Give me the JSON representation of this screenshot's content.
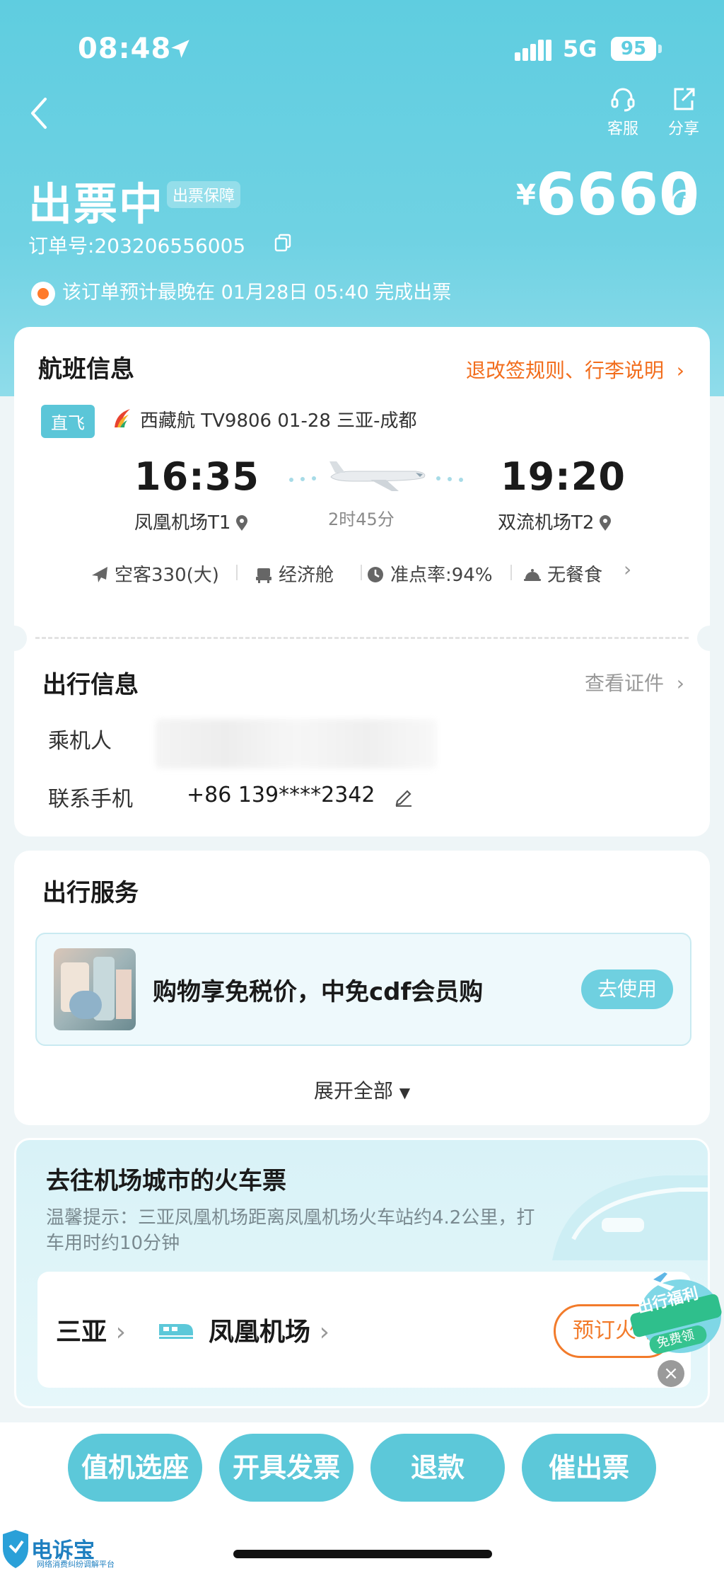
{
  "status_bar": {
    "time": "08:48",
    "network": "5G",
    "battery": "95"
  },
  "header": {
    "service_label": "客服",
    "share_label": "分享",
    "title": "出票中",
    "guarantee_badge": "出票保障",
    "currency": "¥",
    "price": "6660",
    "order_number": "订单号:203206556005",
    "notice": "该订单预计最晚在 01月28日 05:40 完成出票"
  },
  "flight": {
    "section_title": "航班信息",
    "rules_link": "退改签规则、行李说明",
    "direct_tag": "直飞",
    "flight_line": "西藏航 TV9806  01-28 三亚-成都",
    "depart_time": "16:35",
    "depart_airport": "凤凰机场T1",
    "arrive_time": "19:20",
    "arrive_airport": "双流机场T2",
    "duration": "2时45分",
    "aircraft": "空客330(大)",
    "cabin": "经济舱",
    "punctuality": "准点率:94%",
    "meal": "无餐食"
  },
  "travel_info": {
    "section_title": "出行信息",
    "view_id_link": "查看证件",
    "passenger_label": "乘机人",
    "contact_label": "联系手机",
    "contact_value": "+86 139****2342"
  },
  "services": {
    "section_title": "出行服务",
    "item_text": "购物享免税价，中免cdf会员购",
    "item_button": "去使用",
    "expand_label": "展开全部"
  },
  "train": {
    "title": "去往机场城市的火车票",
    "tip": "温馨提示：三亚凤凰机场距离凤凰机场火车站约4.2公里，打车用时约10分钟",
    "from": "三亚",
    "to": "凤凰机场",
    "book_button": "预订火车票",
    "promo_line1": "出行福利",
    "promo_line2": "免费领"
  },
  "bottom_actions": {
    "checkin": "值机选座",
    "invoice": "开具发票",
    "refund": "退款",
    "urge": "催出票"
  },
  "watermark": {
    "name": "电诉宝",
    "sub": "网络消费纠纷调解平台"
  },
  "colors": {
    "accent": "#5cc8d9",
    "orange": "#f26d1c",
    "header_bg": "#64cfe1"
  }
}
